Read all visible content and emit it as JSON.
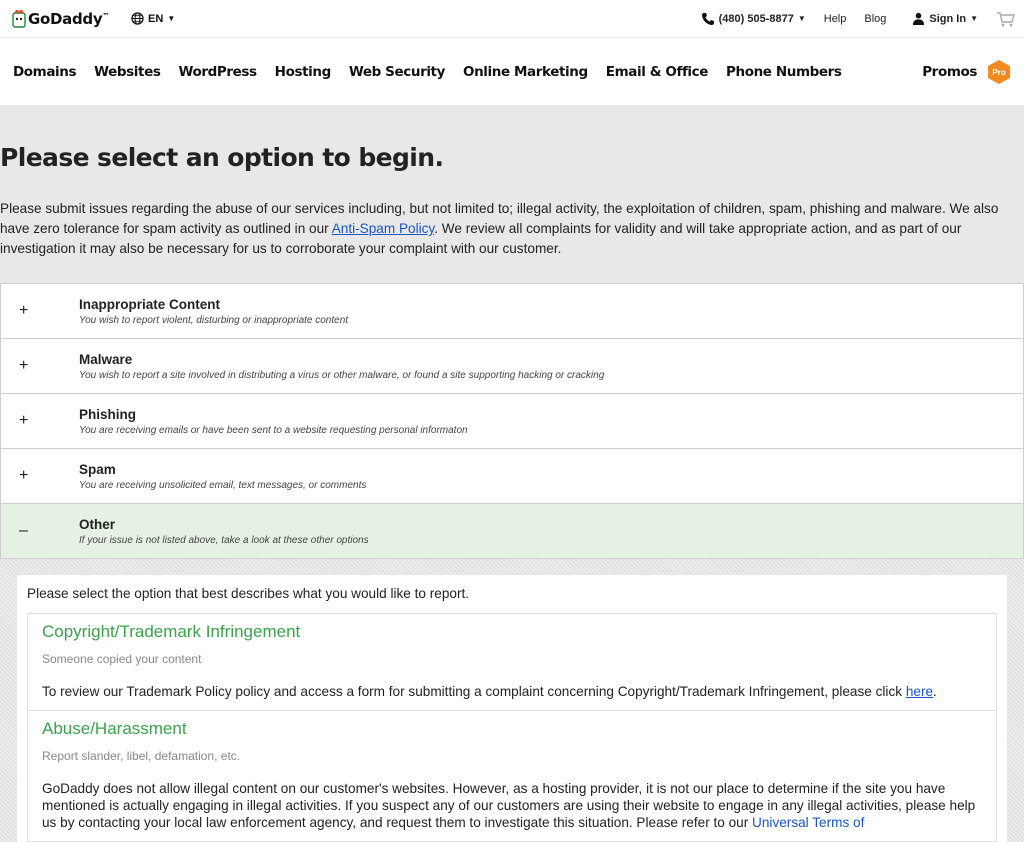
{
  "header": {
    "logo_text": "GoDaddy",
    "logo_tm": "™",
    "language": "EN",
    "phone": "(480) 505-8877",
    "help": "Help",
    "blog": "Blog",
    "sign_in": "Sign In"
  },
  "nav": {
    "items": [
      "Domains",
      "Websites",
      "WordPress",
      "Hosting",
      "Web Security",
      "Online Marketing",
      "Email & Office",
      "Phone Numbers"
    ],
    "promos": "Promos",
    "pro_badge": "Pro"
  },
  "hero": {
    "title": "Please select an option to begin.",
    "text_before_link": "Please submit issues regarding the abuse of our services including, but not limited to; illegal activity, the exploitation of children, spam, phishing and malware. We also have zero tolerance for spam activity as outlined in our ",
    "link_text": "Anti-Spam Policy",
    "text_after_link": ". We review all complaints for validity and will take appropriate action, and as part of our investigation it may also be necessary for us to corroborate your complaint with our customer."
  },
  "accordion": [
    {
      "sign": "+",
      "title": "Inappropriate Content",
      "subtitle": "You wish to report violent, disturbing or inappropriate content"
    },
    {
      "sign": "+",
      "title": "Malware",
      "subtitle": "You wish to report a site involved in distributing a virus or other malware, or found a site supporting hacking or cracking"
    },
    {
      "sign": "+",
      "title": "Phishing",
      "subtitle": "You are receiving emails or have been sent to a website requesting personal informaton"
    },
    {
      "sign": "+",
      "title": "Spam",
      "subtitle": "You are receiving unsolicited email, text messages, or comments"
    },
    {
      "sign": "–",
      "title": "Other",
      "subtitle": "If your issue is not listed above, take a look at these other options"
    }
  ],
  "panel": {
    "intro": "Please select the option that best describes what you would like to report.",
    "cards": [
      {
        "title": "Copyright/Trademark Infringement",
        "subtitle": "Someone copied your content",
        "body_before_link": "To review our Trademark Policy policy and access a form for submitting a complaint concerning Copyright/Trademark Infringement, please click ",
        "link_text": "here",
        "body_after_link": "."
      },
      {
        "title": "Abuse/Harassment",
        "subtitle": "Report slander, libel, defamation, etc.",
        "body_before_link": "GoDaddy does not allow illegal content on our customer's websites. However, as a hosting provider, it is not our place to determine if the site you have mentioned is actually engaging in illegal activities. If you suspect any of our customers are using their website to engage in any illegal activities, please help us by contacting your local law enforcement agency, and request them to investigate this situation. Please refer to our ",
        "link_text": "Universal Terms of",
        "body_after_link": ""
      }
    ]
  },
  "colors": {
    "link": "#1a55c4",
    "green_title": "#3aa34a",
    "open_row_bg": "#e5f2e3",
    "pro_badge": "#f58a1f"
  }
}
